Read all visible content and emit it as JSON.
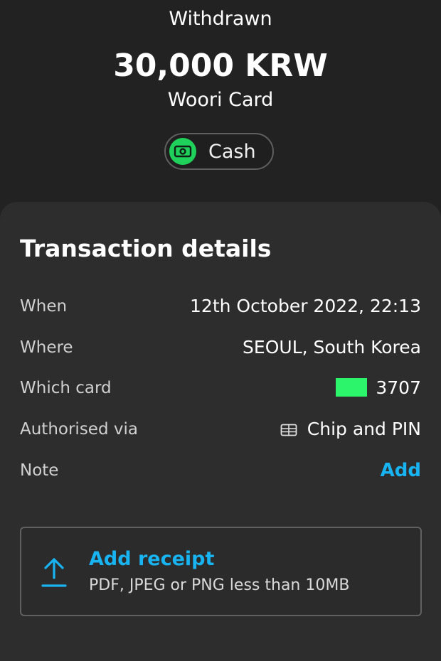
{
  "header": {
    "status": "Withdrawn",
    "amount": "30,000 KRW",
    "merchant": "Woori Card",
    "category": {
      "label": "Cash",
      "icon": "cash-icon",
      "color": "#1fd15a"
    }
  },
  "details": {
    "title": "Transaction details",
    "rows": [
      {
        "label": "When",
        "value": "12th October 2022, 22:13"
      },
      {
        "label": "Where",
        "value": "SEOUL, South Korea"
      },
      {
        "label": "Which card",
        "value": "3707"
      },
      {
        "label": "Authorised via",
        "value": "Chip and PIN"
      },
      {
        "label": "Note",
        "value": "Add"
      }
    ]
  },
  "receipt": {
    "title": "Add receipt",
    "subtitle": "PDF, JPEG or PNG less than 10MB"
  },
  "colors": {
    "background": "#222222",
    "card": "#2d2d2d",
    "accent": "#18b4f2",
    "card_mask": "#2cf56b"
  }
}
